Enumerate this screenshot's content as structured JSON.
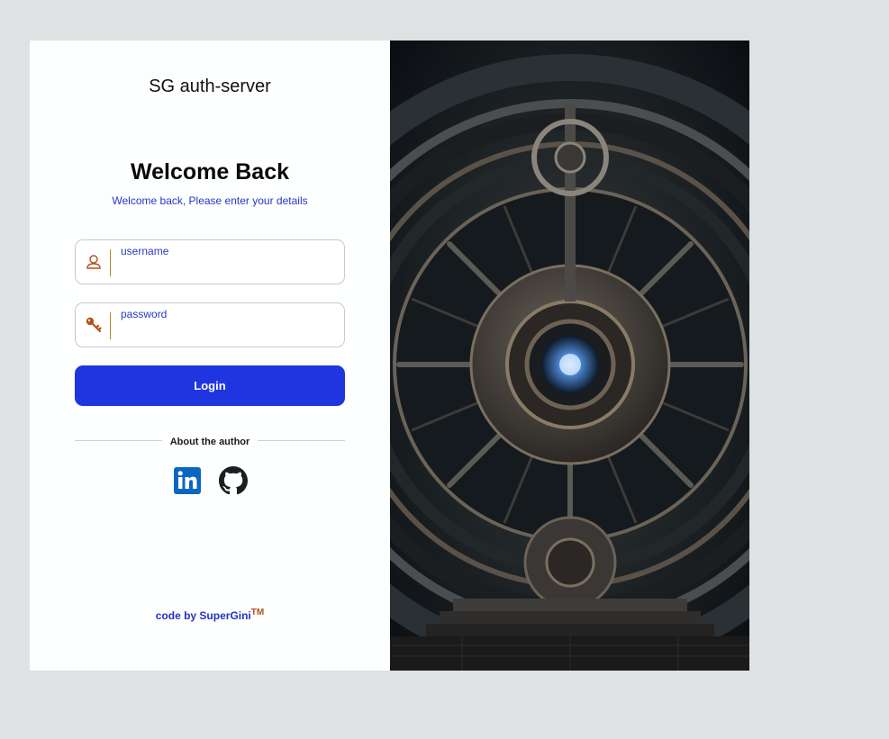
{
  "brand": "SG auth-server",
  "welcome": {
    "title": "Welcome Back",
    "subtitle": "Welcome back, Please enter your details"
  },
  "form": {
    "username_label": "username",
    "username_value": "",
    "password_label": "password",
    "password_value": "",
    "login_label": "Login"
  },
  "about": {
    "label": "About the author",
    "links": [
      {
        "icon": "linkedin-icon"
      },
      {
        "icon": "github-icon"
      }
    ]
  },
  "footer": {
    "prefix": "code by SuperGini",
    "trademark": "TM"
  },
  "colors": {
    "accent": "#1f35e0",
    "label_text": "#2a39c0",
    "icon_orange": "#b4501a",
    "divider_gold": "#b8862d",
    "linkedin": "#0a66c2",
    "page_bg": "#dfe2e3"
  },
  "hero_image": {
    "icon": "vault-door-image"
  }
}
